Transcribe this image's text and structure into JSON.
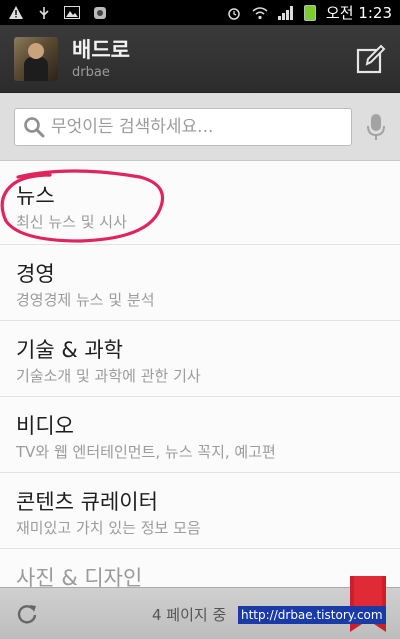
{
  "status_bar": {
    "time_period": "오전",
    "time": "1:23"
  },
  "header": {
    "title": "배드로",
    "subtitle": "drbae",
    "compose_icon": "compose-icon"
  },
  "search": {
    "placeholder": "무엇이든 검색하세요..."
  },
  "list": {
    "items": [
      {
        "title": "뉴스",
        "desc": "최신 뉴스 및 시사"
      },
      {
        "title": "경영",
        "desc": "경영경제 뉴스 및 분석"
      },
      {
        "title": "기술 & 과학",
        "desc": "기술소개 및 과학에 관한 기사"
      },
      {
        "title": "비디오",
        "desc": "TV와 웹 엔터테인먼트, 뉴스 꼭지, 예고편"
      },
      {
        "title": "콘텐츠 큐레이터",
        "desc": "재미있고 가치 있는 정보 모음"
      },
      {
        "title": "사진 & 디자인",
        "desc": ""
      }
    ]
  },
  "bottom": {
    "page_indicator": "4 페이지 중"
  },
  "watermark": "http://drbae.tistory.com",
  "colors": {
    "accent_red": "#e0245e",
    "bookmark_red": "#cc1f2a",
    "battery_green": "#7dcc2f"
  }
}
